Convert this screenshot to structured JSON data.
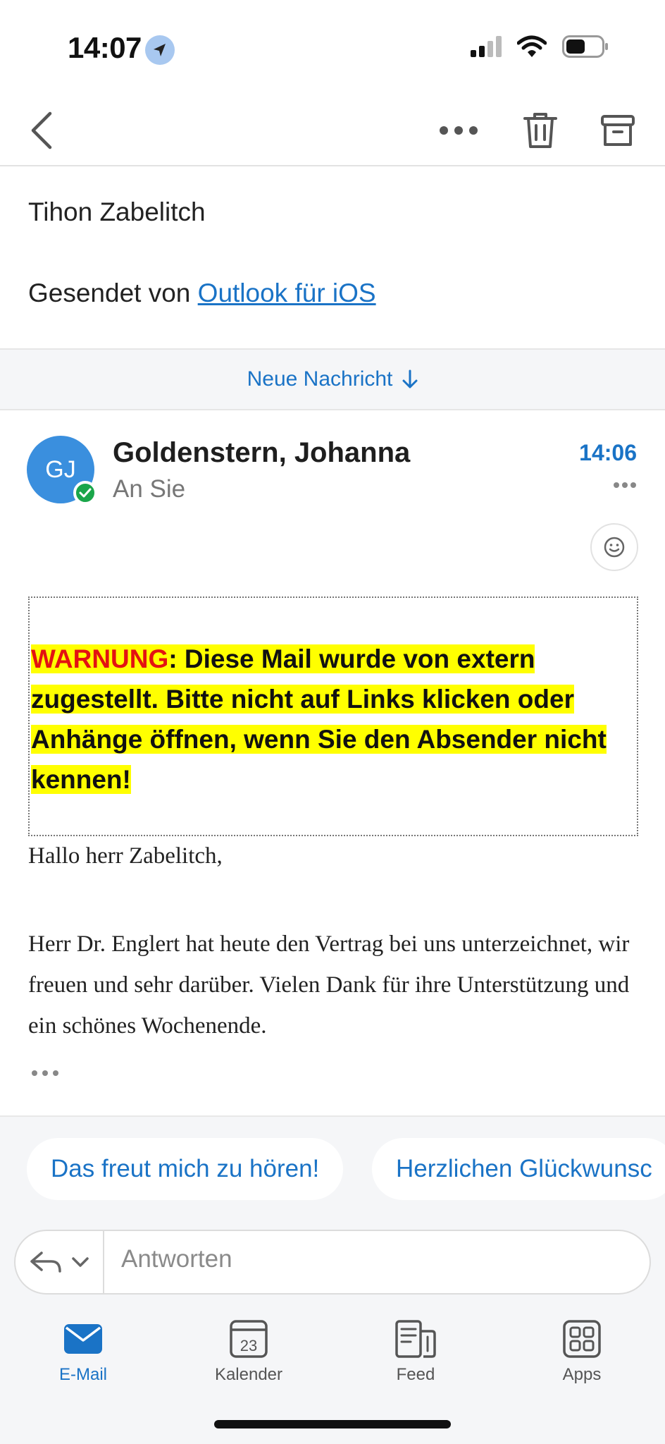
{
  "status_bar": {
    "time": "14:07"
  },
  "previous_message": {
    "sender_name": "Tihon Zabelitch",
    "sent_prefix": "Gesendet von",
    "sent_link": "Outlook für iOS"
  },
  "new_message_banner": {
    "label": "Neue Nachricht"
  },
  "message": {
    "avatar_initials": "GJ",
    "sender": "Goldenstern, Johanna",
    "recipient": "An Sie",
    "time": "14:06",
    "warning_label": "WARNUNG",
    "warning_text": ": Diese Mail wurde von extern zugestellt. Bitte nicht auf Links klicken oder Anhänge öffnen, wenn Sie den Absender nicht kennen!",
    "greeting": "Hallo herr Zabelitch,",
    "body": "Herr Dr. Englert hat heute den Vertrag bei uns unterzeichnet, wir freuen und sehr darüber. Vielen Dank für ihre Unterstützung und ein schönes Wochenende."
  },
  "suggested_replies": [
    "Das freut mich zu hören!",
    "Herzlichen Glückwunsc"
  ],
  "reply": {
    "placeholder": "Antworten"
  },
  "tabs": [
    {
      "label": "E-Mail",
      "icon": "mail-icon"
    },
    {
      "label": "Kalender",
      "icon": "calendar-icon",
      "icon_text": "23"
    },
    {
      "label": "Feed",
      "icon": "feed-icon"
    },
    {
      "label": "Apps",
      "icon": "apps-icon"
    }
  ],
  "colors": {
    "accent": "#1a73c6",
    "avatar": "#3a8fde",
    "warning_highlight": "#ffff00",
    "warning_red": "#e31212"
  }
}
